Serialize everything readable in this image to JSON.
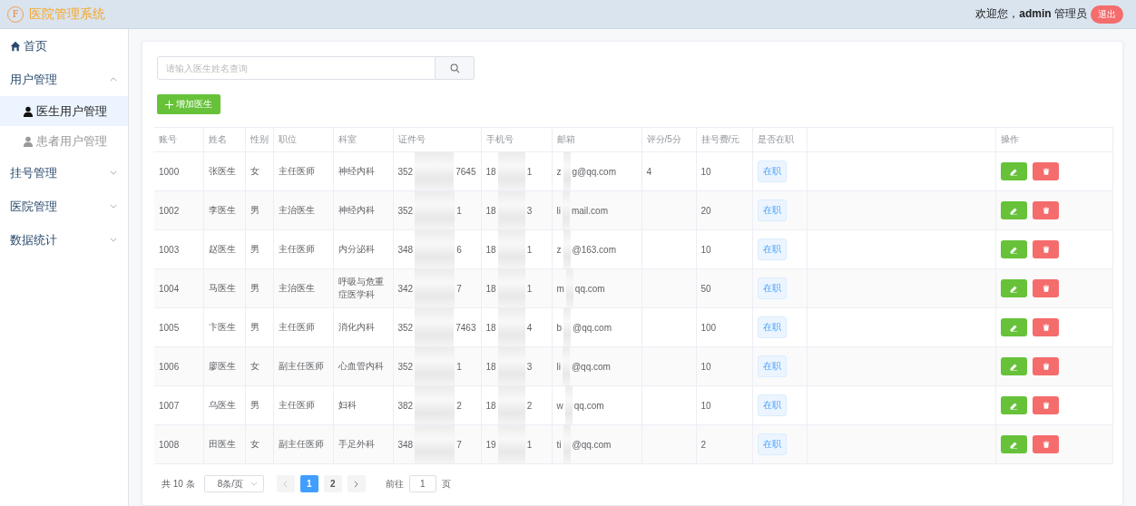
{
  "header": {
    "logo_letter": "F",
    "title": "医院管理系统",
    "welcome": "欢迎您，",
    "user": "admin",
    "role": "管理员",
    "logout": "退出"
  },
  "sidebar": {
    "items": [
      {
        "label": "首页",
        "selected": false
      },
      {
        "label": "用户管理",
        "expanded": true,
        "selected": false,
        "children": [
          {
            "label": "医生用户管理",
            "selected": true
          },
          {
            "label": "患者用户管理",
            "selected": false
          }
        ]
      },
      {
        "label": "挂号管理",
        "expanded": false,
        "selected": false
      },
      {
        "label": "医院管理",
        "expanded": false,
        "selected": false
      },
      {
        "label": "数据统计",
        "expanded": false,
        "selected": false
      }
    ]
  },
  "search": {
    "placeholder": "请输入医生姓名查询"
  },
  "add_button": "增加医生",
  "table": {
    "columns": [
      "账号",
      "姓名",
      "性别",
      "职位",
      "科室",
      "证件号",
      "手机号",
      "邮箱",
      "评分/5分",
      "挂号费/元",
      "是否在职",
      "操作"
    ],
    "rows": [
      {
        "account": "1000",
        "name": "张医生",
        "gender": "女",
        "title": "主任医师",
        "dept": "神经内科",
        "id_start": "352",
        "id_end": "7645",
        "phone_start": "18",
        "phone_end": "1",
        "email_start": "z",
        "email_end": "g@qq.com",
        "score": "4",
        "fee": "10",
        "status": "在职"
      },
      {
        "account": "1002",
        "name": "李医生",
        "gender": "男",
        "title": "主治医生",
        "dept": "神经内科",
        "id_start": "352",
        "id_end": "1",
        "phone_start": "18",
        "phone_end": "3",
        "email_start": "li",
        "email_end": "mail.com",
        "fee": "20",
        "status": "在职"
      },
      {
        "account": "1003",
        "name": "赵医生",
        "gender": "男",
        "title": "主任医师",
        "dept": "内分泌科",
        "id_start": "348",
        "id_end": "6",
        "phone_start": "18",
        "phone_end": "1",
        "email_start": "z",
        "email_end": "@163.com",
        "fee": "10",
        "status": "在职"
      },
      {
        "account": "1004",
        "name": "马医生",
        "gender": "男",
        "title": "主治医生",
        "dept": "呼吸与危重症医学科",
        "id_start": "342",
        "id_end": "7",
        "phone_start": "18",
        "phone_end": "1",
        "email_start": "m",
        "email_end": "qq.com",
        "fee": "50",
        "status": "在职"
      },
      {
        "account": "1005",
        "name": "卞医生",
        "gender": "男",
        "title": "主任医师",
        "dept": "消化内科",
        "id_start": "352",
        "id_end": "7463",
        "phone_start": "18",
        "phone_end": "4",
        "email_start": "b",
        "email_end": "@qq.com",
        "fee": "100",
        "status": "在职"
      },
      {
        "account": "1006",
        "name": "廖医生",
        "gender": "女",
        "title": "副主任医师",
        "dept": "心血管内科",
        "id_start": "352",
        "id_end": "1",
        "phone_start": "18",
        "phone_end": "3",
        "email_start": "li",
        "email_end": "@qq.com",
        "fee": "10",
        "status": "在职"
      },
      {
        "account": "1007",
        "name": "乌医生",
        "gender": "男",
        "title": "主任医师",
        "dept": "妇科",
        "id_start": "382",
        "id_end": "2",
        "phone_start": "18",
        "phone_end": "2",
        "email_start": "w",
        "email_end": "qq.com",
        "fee": "10",
        "status": "在职"
      },
      {
        "account": "1008",
        "name": "田医生",
        "gender": "女",
        "title": "副主任医师",
        "dept": "手足外科",
        "id_start": "348",
        "id_end": "7",
        "phone_start": "19",
        "phone_end": "1",
        "email_start": "ti",
        "email_end": "@qq.com",
        "fee": "2",
        "status": "在职"
      }
    ]
  },
  "pagination": {
    "total": "共 10 条",
    "page_size": "8条/页",
    "pages": [
      {
        "label": "1",
        "selected": true
      },
      {
        "label": "2",
        "selected": false
      }
    ],
    "goto_label": "前往",
    "goto_value": "1",
    "goto_suffix": "页"
  }
}
